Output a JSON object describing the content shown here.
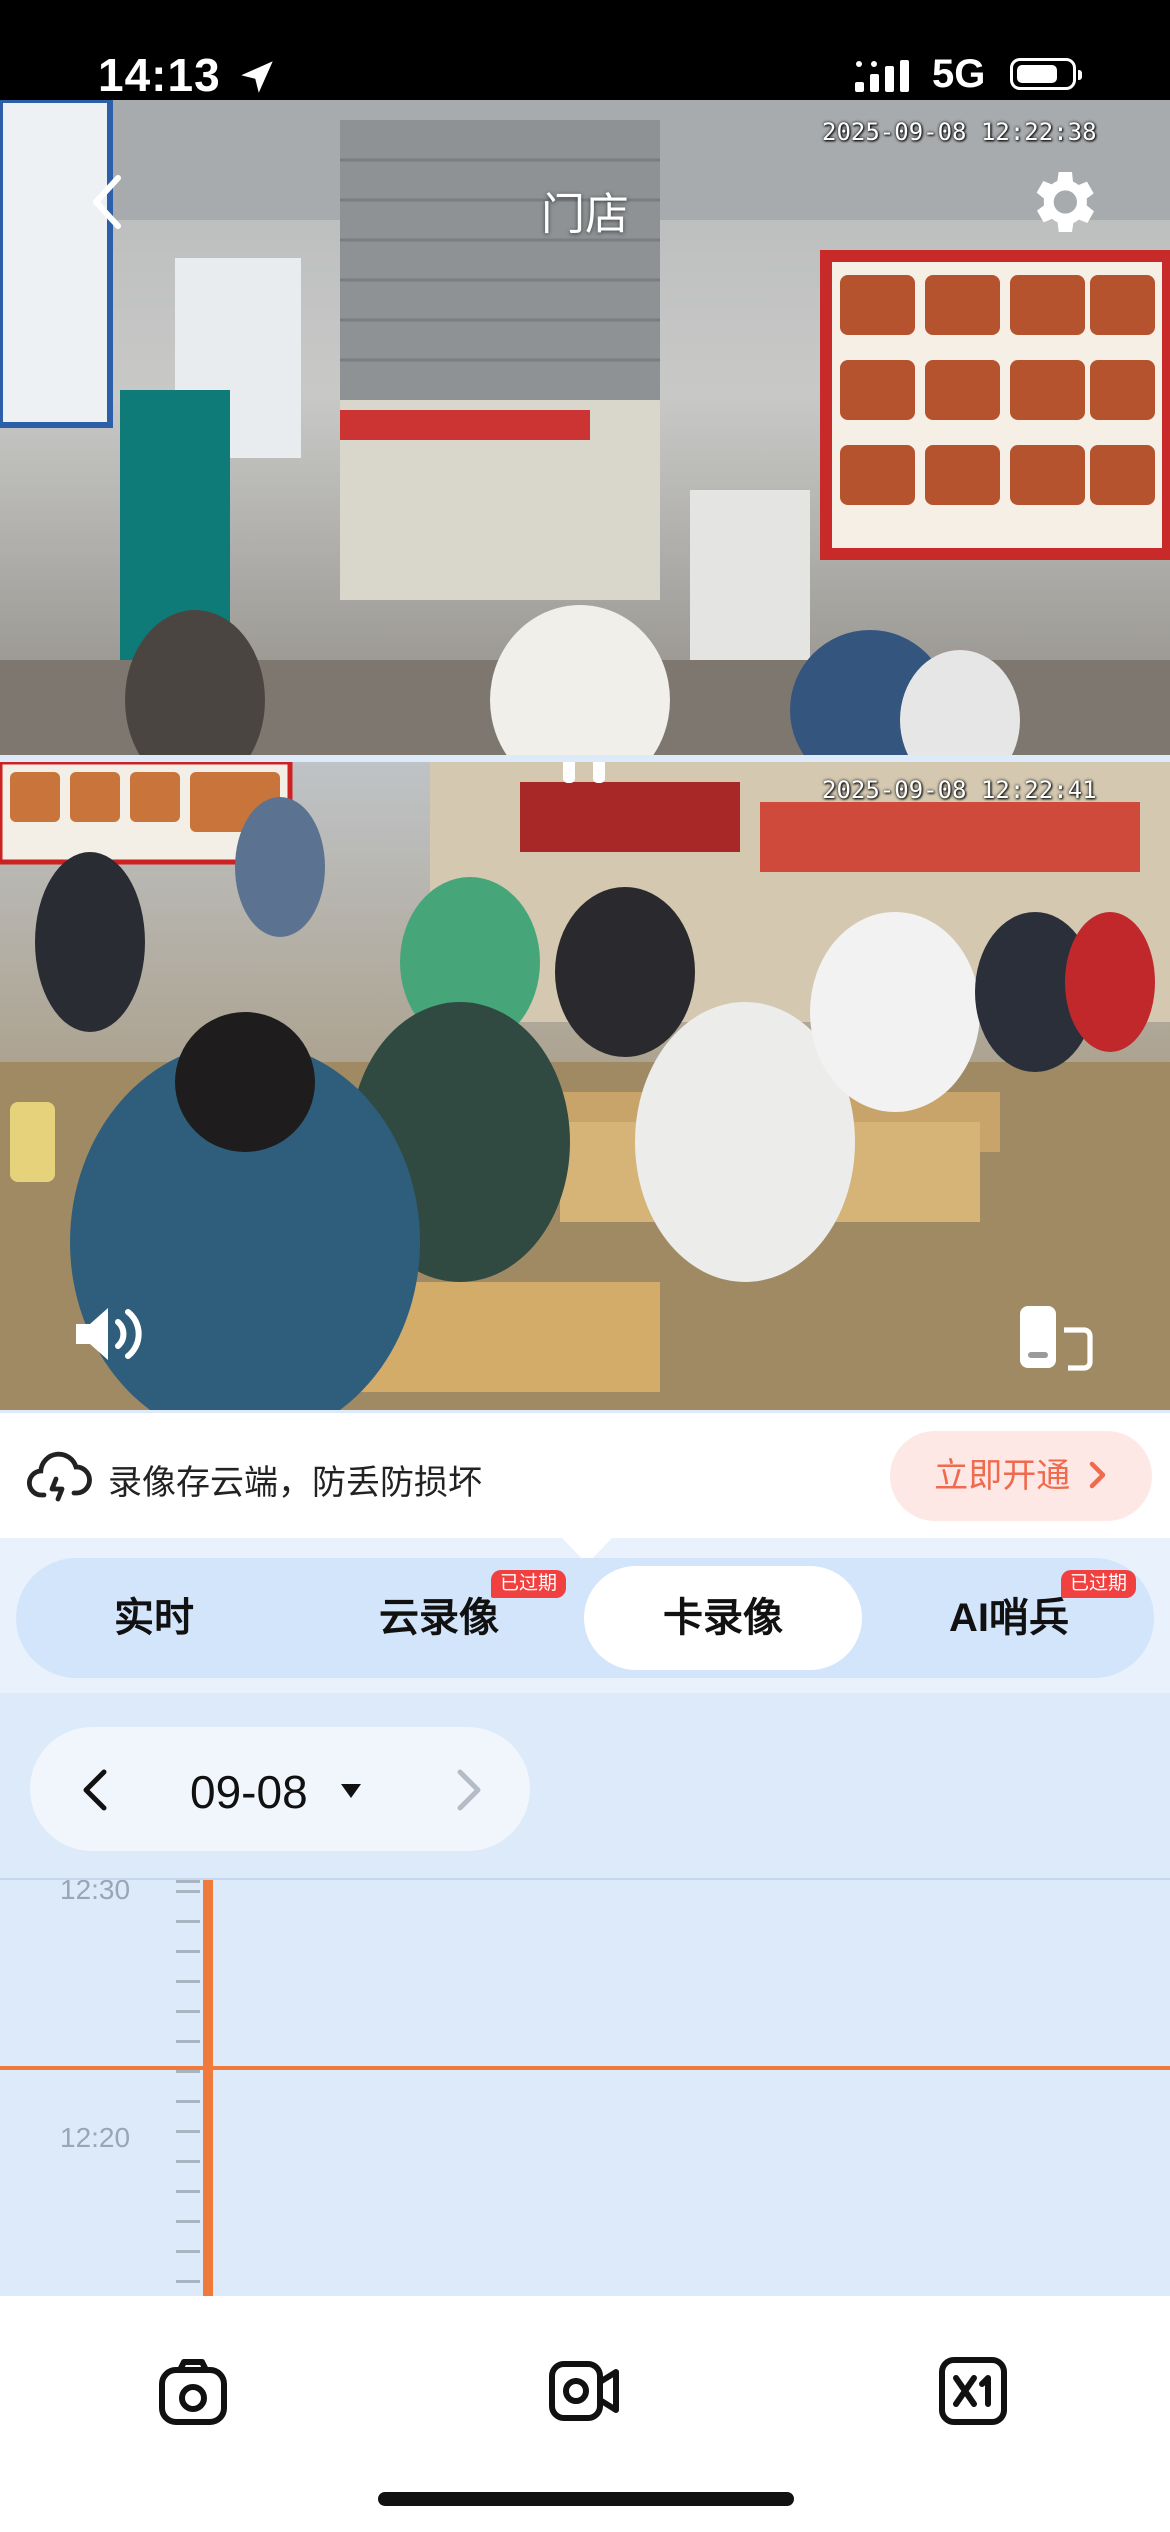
{
  "status_bar": {
    "time": "14:13",
    "network": "5G"
  },
  "feeds": [
    {
      "timestamp": "2025-09-08 12:22:38",
      "title": "门店"
    },
    {
      "timestamp": "2025-09-08 12:22:41"
    }
  ],
  "cloud_banner": {
    "text": "录像存云端，防丢防损坏",
    "button": "立即开通"
  },
  "tabs": [
    {
      "label": "实时"
    },
    {
      "label": "云录像",
      "badge": "已过期"
    },
    {
      "label": "卡录像",
      "active": true
    },
    {
      "label": "AI哨兵",
      "badge": "已过期"
    }
  ],
  "date_picker": {
    "date": "09-08"
  },
  "timeline": {
    "labels": [
      "12:30",
      "12:20"
    ]
  },
  "colors": {
    "accent_orange": "#f07a3c",
    "badge_red": "#f04040",
    "tab_bg": "#d3e5fb",
    "timeline_bg": "#dceaf9"
  },
  "icons": [
    "location-arrow-icon",
    "signal-icon",
    "battery-icon",
    "back-icon",
    "gear-icon",
    "pause-icon",
    "speaker-icon",
    "rotate-screen-icon",
    "cloud-icon",
    "chevron-right-icon",
    "chevron-left-icon",
    "caret-down-icon",
    "camera-icon",
    "video-record-icon",
    "speed-x1-icon"
  ]
}
